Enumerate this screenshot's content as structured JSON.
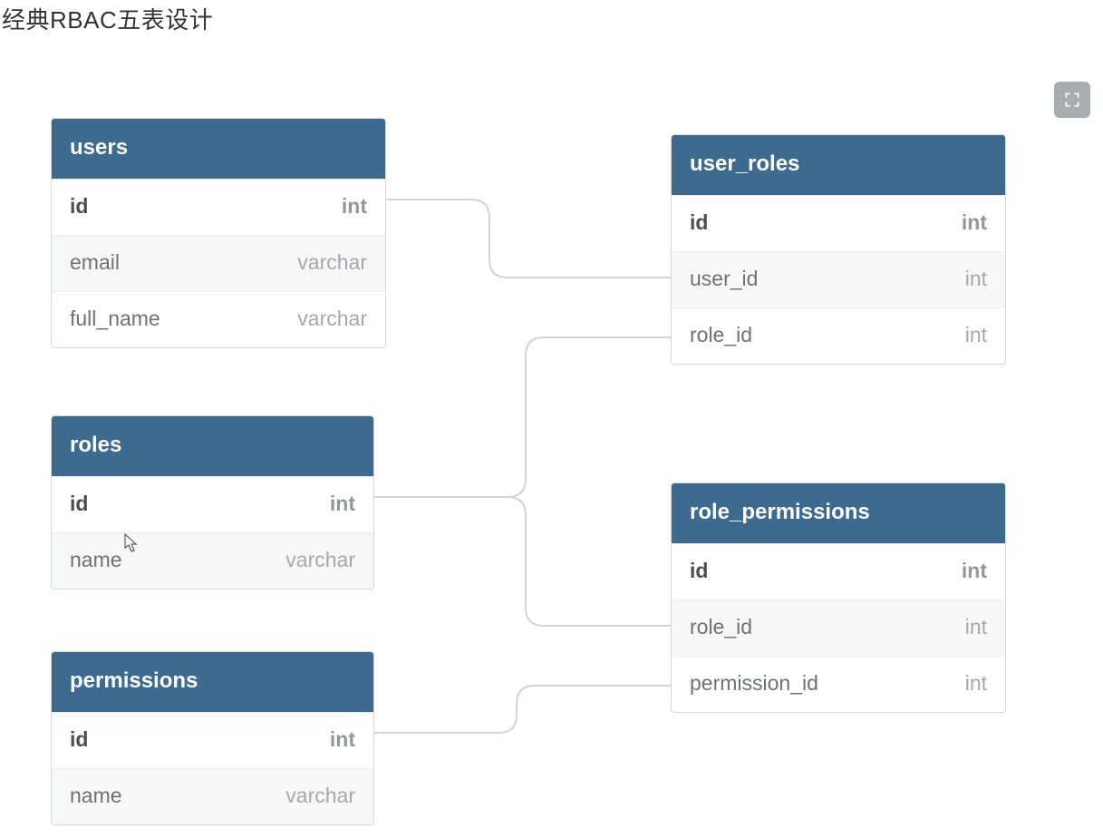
{
  "title": "经典RBAC五表设计",
  "colors": {
    "header_bg": "#3d6a8f",
    "header_fg": "#ffffff",
    "border": "#d7d9da",
    "alt_row": "#f6f7f7",
    "text_name": "#6f7274",
    "text_type": "#a6a9ab",
    "connector": "#d2d4d5",
    "btn_bg": "#a9adaf"
  },
  "tables": {
    "users": {
      "name": "users",
      "columns": [
        {
          "name": "id",
          "type": "int",
          "pk": true
        },
        {
          "name": "email",
          "type": "varchar",
          "pk": false
        },
        {
          "name": "full_name",
          "type": "varchar",
          "pk": false
        }
      ]
    },
    "roles": {
      "name": "roles",
      "columns": [
        {
          "name": "id",
          "type": "int",
          "pk": true
        },
        {
          "name": "name",
          "type": "varchar",
          "pk": false
        }
      ]
    },
    "permissions": {
      "name": "permissions",
      "columns": [
        {
          "name": "id",
          "type": "int",
          "pk": true
        },
        {
          "name": "name",
          "type": "varchar",
          "pk": false
        }
      ]
    },
    "user_roles": {
      "name": "user_roles",
      "columns": [
        {
          "name": "id",
          "type": "int",
          "pk": true
        },
        {
          "name": "user_id",
          "type": "int",
          "pk": false
        },
        {
          "name": "role_id",
          "type": "int",
          "pk": false
        }
      ]
    },
    "role_permissions": {
      "name": "role_permissions",
      "columns": [
        {
          "name": "id",
          "type": "int",
          "pk": true
        },
        {
          "name": "role_id",
          "type": "int",
          "pk": false
        },
        {
          "name": "permission_id",
          "type": "int",
          "pk": false
        }
      ]
    }
  },
  "relations": [
    {
      "from": "users.id",
      "to": "user_roles.user_id"
    },
    {
      "from": "roles.id",
      "to": "user_roles.role_id"
    },
    {
      "from": "roles.id",
      "to": "role_permissions.role_id"
    },
    {
      "from": "permissions.id",
      "to": "role_permissions.permission_id"
    }
  ]
}
